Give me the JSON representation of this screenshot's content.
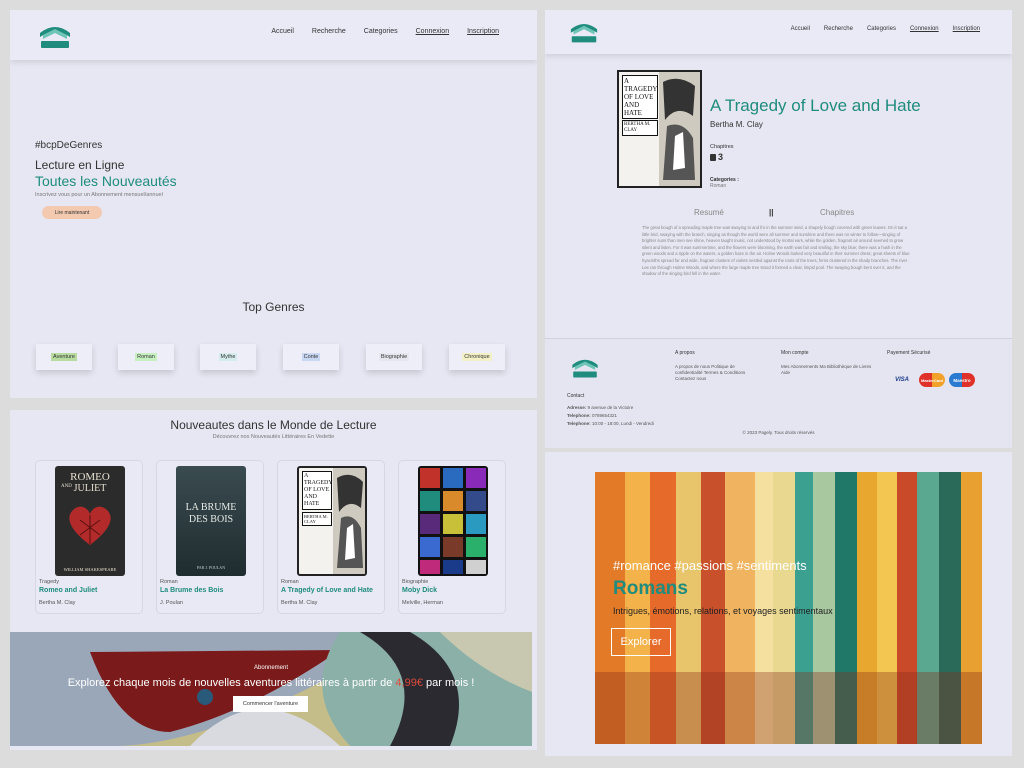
{
  "nav": {
    "links": [
      "Accueil",
      "Recherche",
      "Categories",
      "Connexion",
      "Inscription"
    ]
  },
  "hero": {
    "hashtag": "#bcpDeGenres",
    "line1": "Lecture en Ligne",
    "line2": "Toutes les Nouveautés",
    "subtitle": "Inscrivez vous pour un Abonnement mensuel/annuel",
    "cta": "Lire maintenant"
  },
  "top_genres": {
    "title": "Top Genres",
    "items": [
      "Aventure",
      "Roman",
      "Mythe",
      "Conte",
      "Biographie",
      "Chronique"
    ],
    "colors": [
      "#b8dca0",
      "#c6f0c0",
      "#d4ecec",
      "#c9d8f2",
      "#e6e6ef",
      "#f4f0c6"
    ]
  },
  "new_books": {
    "title": "Nouveautes dans le Monde de Lecture",
    "subtitle": "Découvrez nos Nouveautés Littéraires En Vedette",
    "books": [
      {
        "category": "Tragedy",
        "title": "Romeo and Juliet",
        "author": "Bertha M. Clay",
        "cover_top": "ROMEO",
        "cover_mid": "AND",
        "cover_bottom": "JULIET",
        "cover_author": "WILLIAM SHAKESPEARE"
      },
      {
        "category": "Roman",
        "title": "La Brume des Bois",
        "author": "J. Poulan",
        "cover_top": "LA BRUME",
        "cover_bottom": "DES BOIS",
        "cover_author": "PAR J. POULAN"
      },
      {
        "category": "Roman",
        "title": "A Tragedy of Love and Hate",
        "author": "Bertha M. Clay",
        "cover_top": "A TRAGEDY OF LOVE AND HATE",
        "cover_author": "BERTHA M. CLAY"
      },
      {
        "category": "Biographie",
        "title": "Moby Dick",
        "author": "Melville, Herman"
      }
    ]
  },
  "subscription": {
    "label": "Abonnement",
    "text_before": "Explorez chaque mois de nouvelles aventures littéraires à partir de",
    "price": "4,99€",
    "text_after": "par mois !",
    "cta": "Commencer l'aventure"
  },
  "detail": {
    "title": "A Tragedy of Love and Hate",
    "author": "Bertha M. Clay",
    "chapters_label": "Chapitres",
    "chapters_count": "3",
    "categories_label": "Categories :",
    "category": "Roman",
    "tab_summary": "Resumé",
    "tab_separator": "||",
    "tab_chapters": "Chapitres",
    "summary": "The great bough of a spreading maple tree was swaying to and fro in the summer wind, a shapely bough covered with green leaves. On it sat a little bird, swaying with the branch, singing as though the world were all summer and sunshine and there was no winter to follow—singing of brighter suns than men see shine, heaven taught music, not understood by mortal ears, while the golden, fragrant air around seemed to grow silent and listen. For it was summertime, and the flowers were blooming, the earth was fair and smiling, the sky blue; there was a hush in the green woods and a ripple on the waters, a golden haze in the air. Holme Woods looked very beautiful in their summer dress; great sheets of blue hyacinths spread far and wide, fragrant clusters of violets nestled against the roots of the trees, ferns clustered in the shady branches. The river Lee ran through Holme Woods, and where the large maple tree stood it formed a clear, limpid pool. The swaying bough bent over it, and the shadow of the singing bird fell in the water."
  },
  "footer": {
    "about_title": "A propos",
    "about_links": "A propos de nous Politique de confidentialité Termes & Conditions Contactez nous",
    "account_title": "Mon compte",
    "account_links": "Mes Abonnements Ma Bibliothèque de Livres Aide",
    "payment_title": "Payement Sécurisé",
    "cards": [
      "VISA",
      "MasterCard",
      "Maestro"
    ],
    "contact_title": "Contact",
    "address_label": "Adresse:",
    "address": "9 avenue de la Victoire",
    "phone_label": "Telephone:",
    "phone": "0789654321",
    "hours_label": "Telephone:",
    "hours": "10:00 - 18:00, Lundi - Vendredi",
    "copyright": "© 2023 Pagely. Tous droits réservés"
  },
  "romans_banner": {
    "hashtags": "#romance #passions #sentiments",
    "title": "Romans",
    "subtitle": "Intrigues, émotions, relations, et voyages sentimentaux",
    "cta": "Explorer"
  }
}
